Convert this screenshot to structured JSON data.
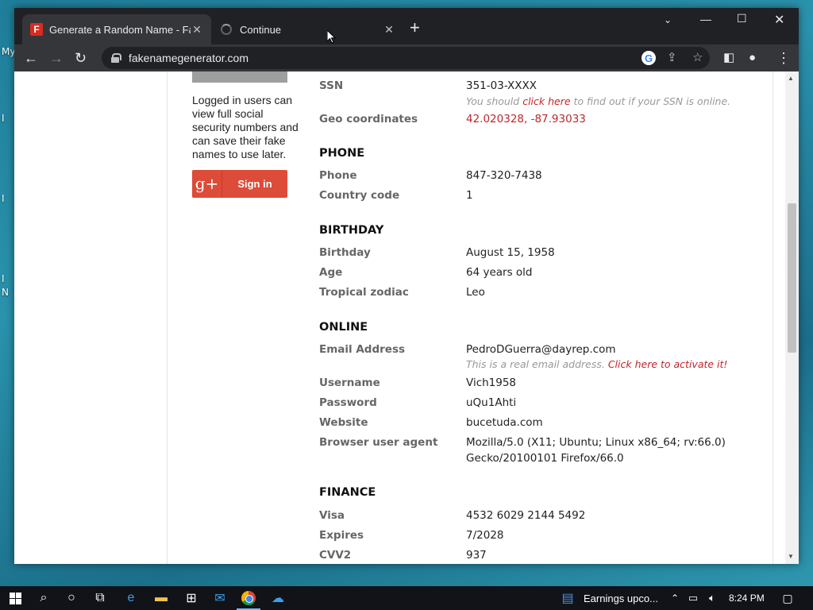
{
  "desktop": {
    "fragments": [
      "My",
      "I",
      "I",
      "I",
      "N"
    ]
  },
  "browser": {
    "tabs": [
      {
        "title": "Generate a Random Name - Fake",
        "favicon": "F"
      },
      {
        "title": "Continue"
      }
    ],
    "url": "fakenamegenerator.com"
  },
  "sidebar": {
    "login_note": "Logged in users can view full social security numbers and can save their fake names to use later.",
    "gplus_glyph": "g+",
    "signin_label": "Sign in"
  },
  "identity": {
    "ssn_label": "SSN",
    "ssn_value": "351-03-XXXX",
    "ssn_note_pre": "You should ",
    "ssn_note_link": "click here",
    "ssn_note_post": " to find out if your SSN is online.",
    "geo_label": "Geo coordinates",
    "geo_value": "42.020328, -87.93033"
  },
  "phone": {
    "heading": "PHONE",
    "phone_label": "Phone",
    "phone_value": "847-320-7438",
    "cc_label": "Country code",
    "cc_value": "1"
  },
  "birthday": {
    "heading": "BIRTHDAY",
    "birthday_label": "Birthday",
    "birthday_value": "August 15, 1958",
    "age_label": "Age",
    "age_value": "64 years old",
    "zodiac_label": "Tropical zodiac",
    "zodiac_value": "Leo"
  },
  "online": {
    "heading": "ONLINE",
    "email_label": "Email Address",
    "email_value": "PedroDGuerra@dayrep.com",
    "email_note": "This is a real email address. ",
    "email_note_link": "Click here to activate it!",
    "username_label": "Username",
    "username_value": "Vich1958",
    "password_label": "Password",
    "password_value": "uQu1Ahti",
    "website_label": "Website",
    "website_value": "bucetuda.com",
    "ua_label": "Browser user agent",
    "ua_line1": "Mozilla/5.0 (X11; Ubuntu; Linux x86_64; rv:66.0)",
    "ua_line2": "Gecko/20100101 Firefox/66.0"
  },
  "finance": {
    "heading": "FINANCE",
    "visa_label": "Visa",
    "visa_value": "4532 6029 2144 5492",
    "expires_label": "Expires",
    "expires_value": "7/2028",
    "cvv_label": "CVV2",
    "cvv_value": "937"
  },
  "taskbar": {
    "news": "Earnings upco...",
    "time": "8:24 PM"
  },
  "colors": {
    "accent_red": "#c0262b",
    "gplus_red": "#dd4b39"
  }
}
